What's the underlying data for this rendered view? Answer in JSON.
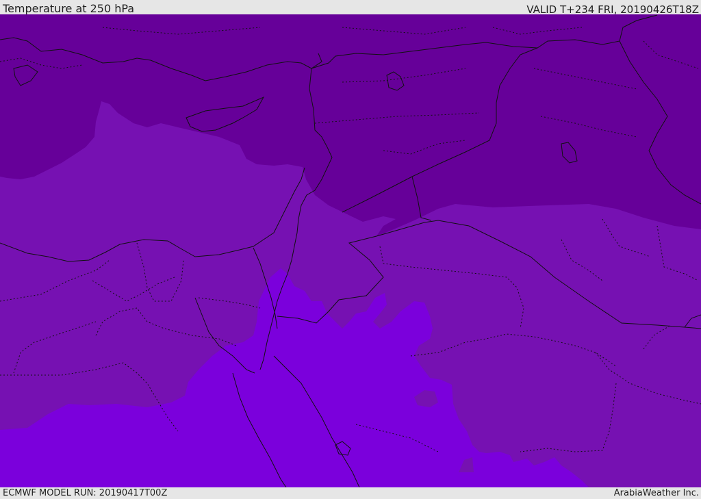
{
  "header": {
    "title": "Temperature at 250 hPa",
    "valid": "VALID T+234 FRI, 20190426T18Z"
  },
  "footer": {
    "model_run": "ECMWF MODEL RUN: 20190417T00Z",
    "credit": "ArabiaWeather Inc."
  },
  "map": {
    "field": "Temperature at 250 hPa",
    "colors": {
      "band_cold": "#660099",
      "band_mid": "#7611b2",
      "band_warm": "#7b00dc",
      "boundary_line": "#111111"
    }
  }
}
